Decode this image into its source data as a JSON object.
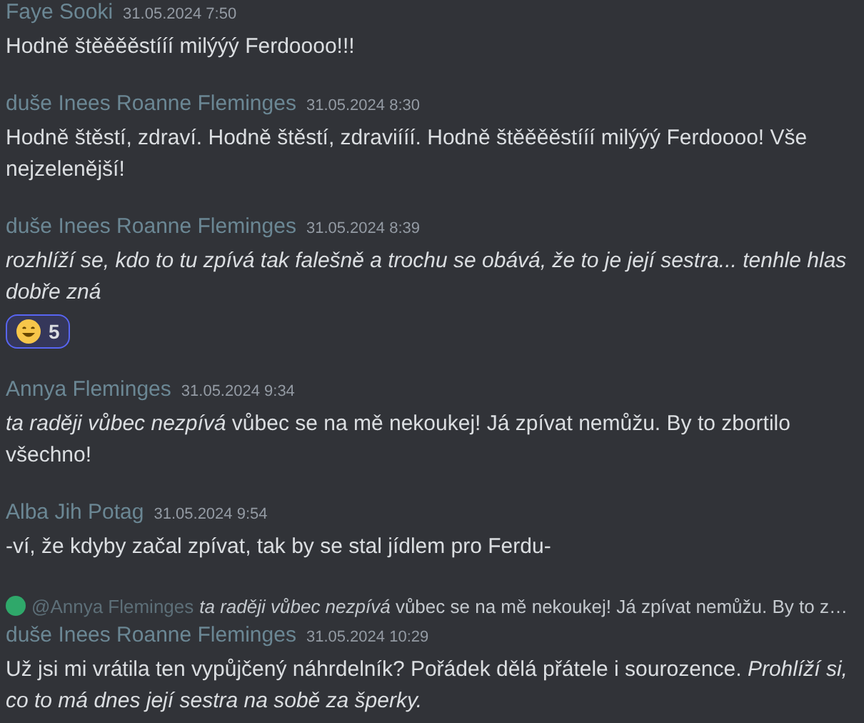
{
  "messages": [
    {
      "author": "Faye Sooki",
      "time": "31.05.2024 7:50",
      "text": "Hodně štěěěěstííí milýýý Ferdoooo!!!"
    },
    {
      "author": "duše Inees Roanne Fleminges",
      "time": "31.05.2024 8:30",
      "text": "Hodně štěstí, zdraví. Hodně štěstí, zdraviííí. Hodně štěěěěstííí milýýý Ferdoooo! Vše nejzelenější!"
    },
    {
      "author": "duše Inees Roanne Fleminges",
      "time": "31.05.2024 8:39",
      "text": "*rozhlíží se, kdo to tu zpívá tak falešně a trochu se obává, že to je její sestra... tenhle hlas dobře zná*",
      "reactions": [
        {
          "count": "5",
          "selected": true
        }
      ]
    },
    {
      "author": "Annya Fleminges",
      "time": "31.05.2024 9:34",
      "text": "*ta raději vůbec nezpívá* vůbec se na mě nekoukej! Já zpívat nemůžu. By to zbortilo všechno!"
    },
    {
      "author": "Alba Jih Potag",
      "time": "31.05.2024 9:54",
      "text": "-ví, že kdyby začal zpívat, tak by se stal jídlem pro Ferdu-"
    },
    {
      "reply": {
        "author": "@Annya Fleminges",
        "text": "*ta raději vůbec nezpívá* vůbec se na mě nekoukej! Já zpívat nemůžu. By to z…"
      },
      "author": "duše Inees Roanne Fleminges",
      "time": "31.05.2024 10:29",
      "text": "Už jsi mi vrátila ten vypůjčený náhrdelník? Pořádek dělá přátele i sourozence.  *Prohlíží si, co to má dnes její sestra na sobě za šperky.*"
    }
  ]
}
